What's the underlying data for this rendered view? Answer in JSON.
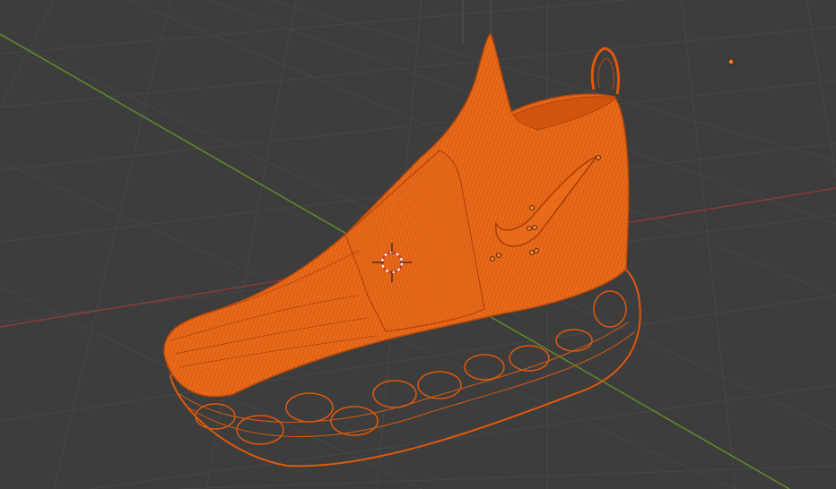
{
  "viewport": {
    "view_mode": "3D viewport",
    "shading": "wireframe",
    "background_color": "#3d3d3d",
    "grid_color": "#4a4a4a",
    "x_axis_color": "#9a3a3a",
    "y_axis_color": "#5f8c2a",
    "z_axis_color": "#555555"
  },
  "selection": {
    "object": "shoe-mesh",
    "selected": true,
    "highlight_color": "#ff6a12",
    "wire_color": "#e0580a",
    "wire_dark_color": "#c04a08"
  },
  "icons": {
    "cursor": "3d-cursor-icon",
    "origin": "object-origin-icon"
  }
}
